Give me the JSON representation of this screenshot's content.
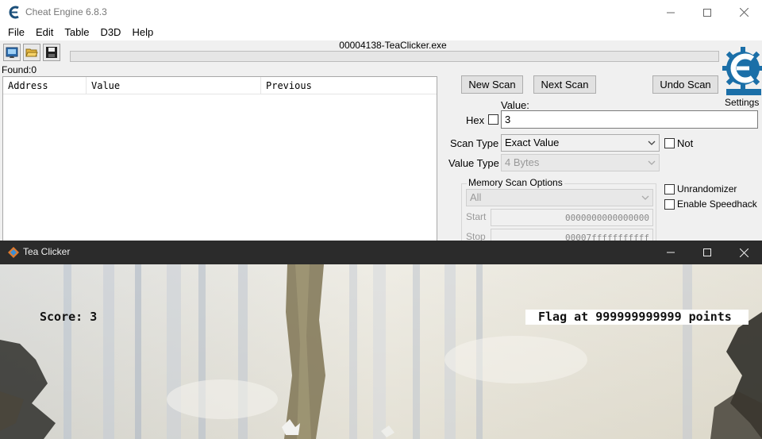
{
  "cheat_engine": {
    "title": "Cheat Engine 6.8.3",
    "menu": [
      "File",
      "Edit",
      "Table",
      "D3D",
      "Help"
    ],
    "toolbar_icons": [
      "select-process-icon",
      "open-file-icon",
      "save-icon"
    ],
    "process_title": "00004138-TeaClicker.exe",
    "found": "Found:0",
    "settings_label": "Settings",
    "results_columns": [
      "Address",
      "Value",
      "Previous"
    ],
    "buttons": {
      "new_scan": "New Scan",
      "next_scan": "Next Scan",
      "undo_scan": "Undo Scan"
    },
    "value_label": "Value:",
    "hex_label": "Hex",
    "hex_checked": false,
    "value_input": "3",
    "scan_type_label": "Scan Type",
    "scan_type_value": "Exact Value",
    "value_type_label": "Value Type",
    "value_type_value": "4 Bytes",
    "not_label": "Not",
    "not_checked": false,
    "memory_scan_options": "Memory Scan Options",
    "memory_region": "All",
    "start_label": "Start",
    "start_value": "0000000000000000",
    "stop_label": "Stop",
    "stop_value": "00007fffffffffff",
    "unrandomizer_label": "Unrandomizer",
    "speedhack_label": "Enable Speedhack",
    "logo_text": "Cheat Engine"
  },
  "tea_clicker": {
    "title": "Tea Clicker",
    "score": "Score: 3",
    "flag": "Flag at 999999999999 points"
  },
  "colors": {
    "tea_titlebar": "#2b2b2b",
    "logo_blue": "#1b6fa8",
    "window_bg": "#f0f0f0"
  }
}
